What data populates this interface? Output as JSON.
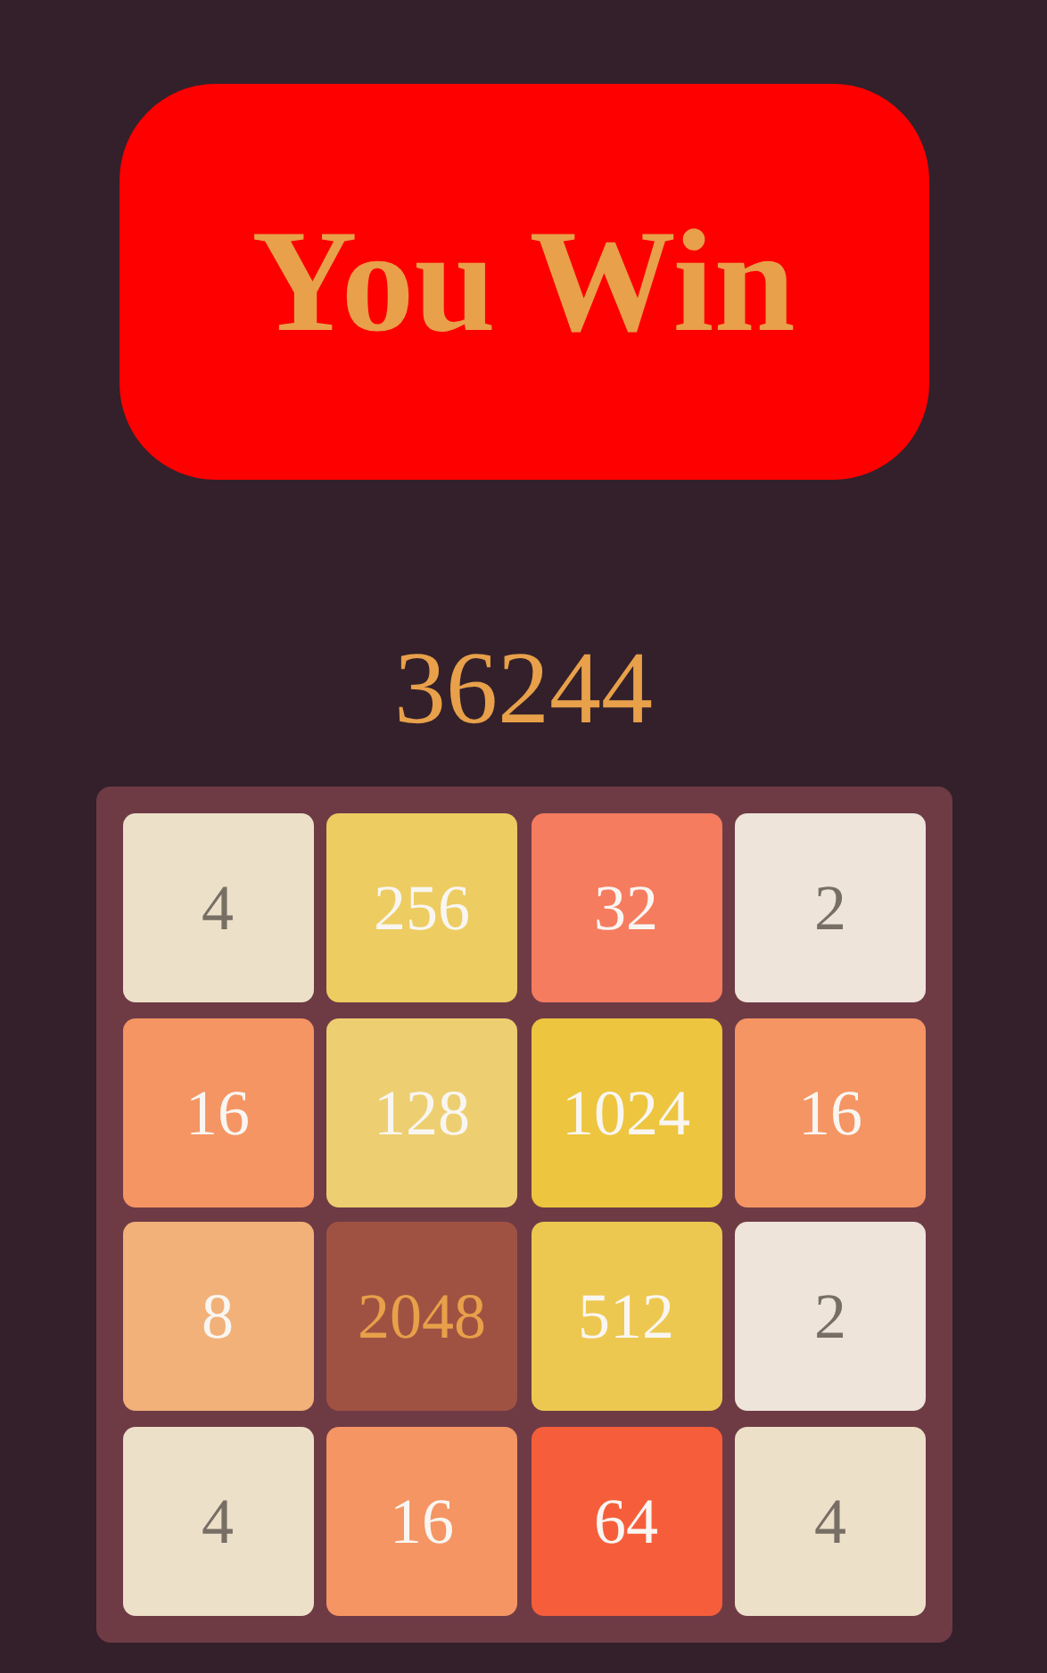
{
  "banner": {
    "text": "You Win"
  },
  "score": "36244",
  "board": {
    "rows": [
      [
        {
          "value": "4",
          "color": "#ede0c8",
          "kind": "dark"
        },
        {
          "value": "256",
          "color": "#edcc61",
          "kind": "light"
        },
        {
          "value": "32",
          "color": "#f67c5f",
          "kind": "light"
        },
        {
          "value": "2",
          "color": "#eee4da",
          "kind": "dark"
        }
      ],
      [
        {
          "value": "16",
          "color": "#f59563",
          "kind": "light"
        },
        {
          "value": "128",
          "color": "#edcf72",
          "kind": "light"
        },
        {
          "value": "1024",
          "color": "#edc53f",
          "kind": "light"
        },
        {
          "value": "16",
          "color": "#f59563",
          "kind": "light"
        }
      ],
      [
        {
          "value": "8",
          "color": "#f2b179",
          "kind": "light"
        },
        {
          "value": "2048",
          "color": "#a05242",
          "kind": "gold"
        },
        {
          "value": "512",
          "color": "#edc850",
          "kind": "light"
        },
        {
          "value": "2",
          "color": "#eee4da",
          "kind": "dark"
        }
      ],
      [
        {
          "value": "4",
          "color": "#ede0c8",
          "kind": "dark"
        },
        {
          "value": "16",
          "color": "#f59563",
          "kind": "light"
        },
        {
          "value": "64",
          "color": "#f65e3b",
          "kind": "light"
        },
        {
          "value": "4",
          "color": "#ede0c8",
          "kind": "dark"
        }
      ]
    ]
  }
}
